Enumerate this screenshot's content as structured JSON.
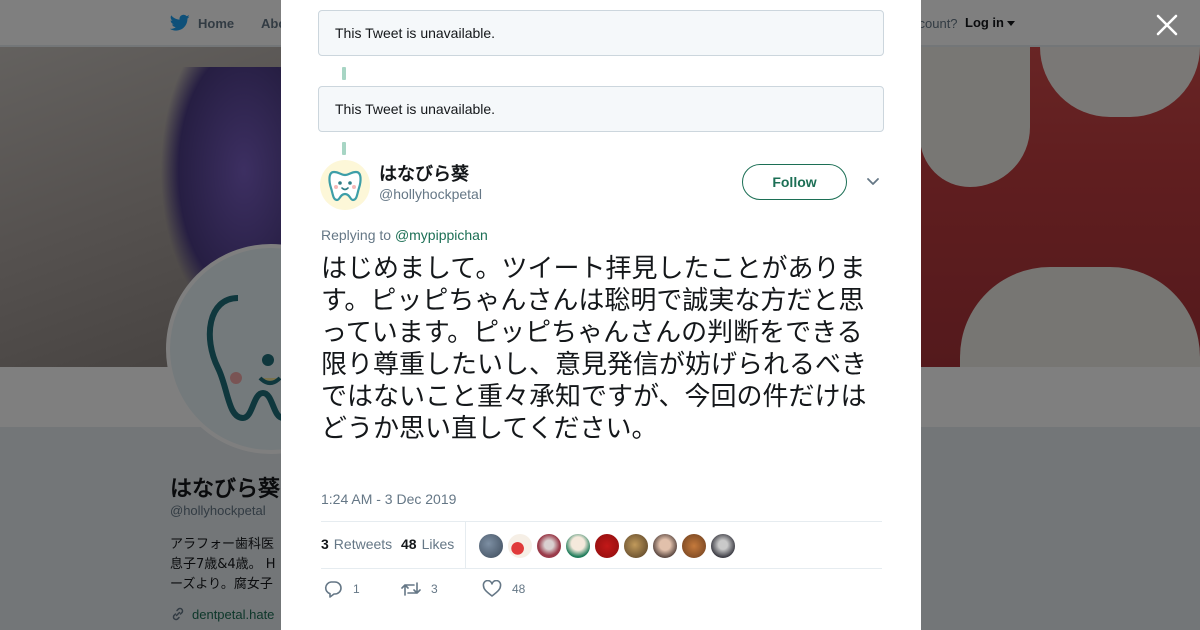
{
  "nav": {
    "home_label": "Home",
    "about_label": "Abo",
    "account_prompt": "ccount?",
    "login_label": "Log in"
  },
  "background_profile": {
    "name": "はなびら葵",
    "handle": "@hollyhockpetal",
    "bio_lines": [
      "アラフォー歯科医",
      "息子7歳&4歳。 H",
      "ーズより。腐女子"
    ],
    "link": "dentpetal.hate"
  },
  "thread": {
    "unavailable_1": "This Tweet is unavailable.",
    "unavailable_2": "This Tweet is unavailable."
  },
  "tweet": {
    "author_name": "はなびら葵",
    "author_handle": "@hollyhockpetal",
    "follow_label": "Follow",
    "replying_prefix": "Replying to",
    "replying_to": "@mypippichan",
    "text": "はじめまして。ツイート拝見したことがあります。ピッピちゃんさんは聡明で誠実な方だと思っています。ピッピちゃんさんの判断をできる限り尊重したいし、意見発信が妨げられるべきではないこと重々承知ですが、今回の件だけはどうか思い直してください。",
    "timestamp": "1:24 AM - 3 Dec 2019",
    "retweets_count": "3",
    "retweets_label": "Retweets",
    "likes_count": "48",
    "likes_label": "Likes",
    "actions": {
      "reply_count": "1",
      "retweet_count": "3",
      "like_count": "48"
    }
  },
  "colors": {
    "accent": "#1c6f55",
    "thread_line": "#a7d5c4",
    "text": "#14171a",
    "muted": "#657786"
  },
  "icons": [
    "twitter-bird-icon",
    "close-icon",
    "chevron-down-icon",
    "reply-icon",
    "retweet-icon",
    "heart-icon",
    "link-icon"
  ]
}
